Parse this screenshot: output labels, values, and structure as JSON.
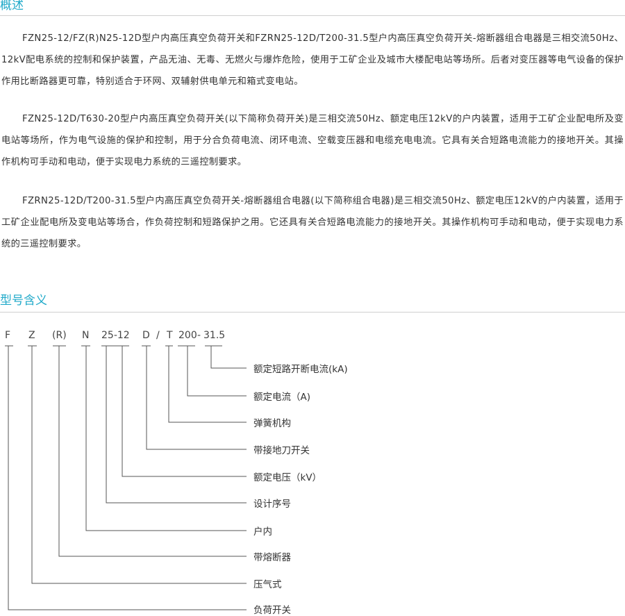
{
  "overview": {
    "title": "概述",
    "paragraphs": [
      "FZN25-12/FZ(R)N25-12D型户内高压真空负荷开关和FZRN25-12D/T200-31.5型户内高压真空负荷开关-熔断器组合电器是三相交流50Hz、12kV配电系统的控制和保护装置，产品无油、无毒、无燃火与爆炸危险，使用于工矿企业及城市大楼配电站等场所。后者对变压器等电气设备的保护作用比断路器更可靠，特别适合于环网、双辅射供电单元和箱式变电站。",
      "FZN25-12D/T630-20型户内高压真空负荷开关(以下简称负荷开关)是三相交流50Hz、额定电压12kV的户内装置，适用于工矿企业配电所及变电站等场所，作为电气设施的保护和控制，用于分合负荷电流、闭环电流、空载变压器和电缆充电电流。它具有关合短路电流能力的接地开关。其操作机构可手动和电动，便于实现电力系统的三遥控制要求。",
      "FZRN25-12D/T200-31.5型户内高压真空负荷开关-熔断器组合电器(以下简称组合电器)是三相交流50Hz、额定电压12kV的户内装置，适用于工矿企业配电所及变电站等场合，作负荷控制和短路保护之用。它还具有关合短路电流能力的接地开关。其操作机构可手动和电动，便于实现电力系统的三遥控制要求。"
    ]
  },
  "model_meaning": {
    "title": "型号含义",
    "codes": [
      "F",
      "Z",
      "(R)",
      "N",
      "25-12",
      "D",
      "/",
      "T",
      "200",
      "-",
      "31.5"
    ],
    "labels": [
      "额定短路开断电流(kA)",
      "额定电流（A)",
      "弹簧机构",
      "带接地刀开关",
      "额定电压（kV）",
      "设计序号",
      "户内",
      "带熔断器",
      "压气式",
      "负荷开关"
    ]
  }
}
